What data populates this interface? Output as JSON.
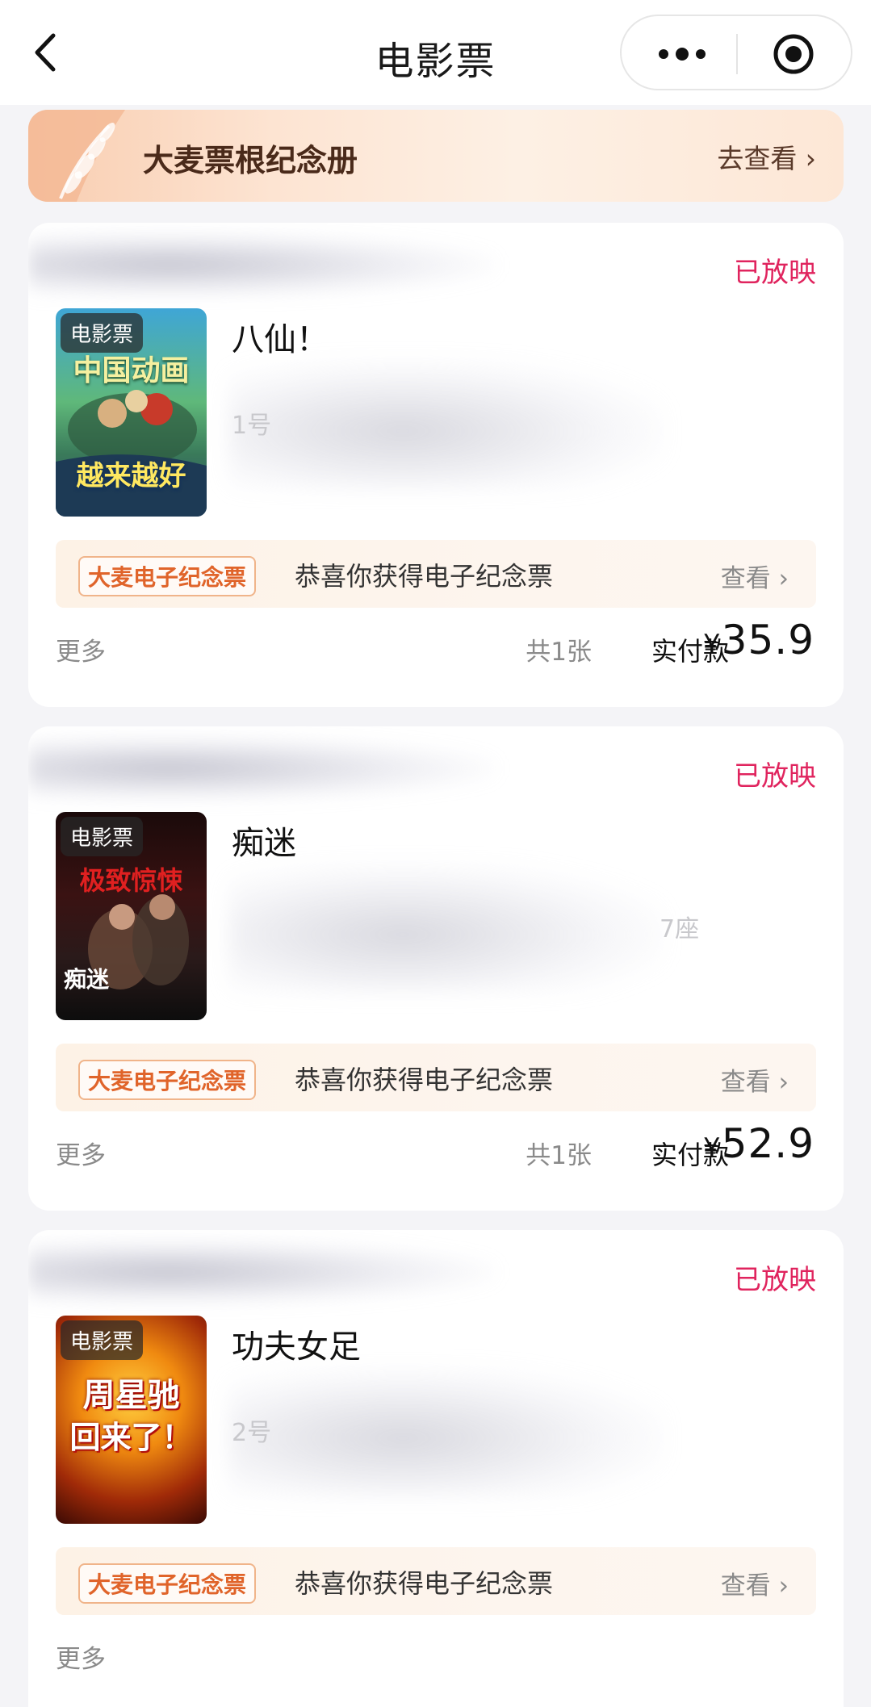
{
  "header": {
    "title": "电影票"
  },
  "banner": {
    "title": "大麦票根纪念册",
    "action": "去查看 ›"
  },
  "orders": [
    {
      "status": "已放映",
      "poster_tag": "电影票",
      "poster_text_top": "中国动画",
      "poster_text_bottom": "越来越好",
      "movie_title": "八仙！",
      "detail_fragment": "1号",
      "souvenir_tag": "大麦电子纪念票",
      "souvenir_msg": "恭喜你获得电子纪念票",
      "souvenir_view": "查看 ›",
      "more": "更多",
      "count": "共1张",
      "paid_label": "实付款",
      "currency": "¥",
      "price": "35.9"
    },
    {
      "status": "已放映",
      "poster_tag": "电影票",
      "poster_text_top": "极致惊悚",
      "poster_text_bottom": "痴迷",
      "movie_title": "痴迷",
      "detail_fragment": "7座",
      "souvenir_tag": "大麦电子纪念票",
      "souvenir_msg": "恭喜你获得电子纪念票",
      "souvenir_view": "查看 ›",
      "more": "更多",
      "count": "共1张",
      "paid_label": "实付款",
      "currency": "¥",
      "price": "52.9"
    },
    {
      "status": "已放映",
      "poster_tag": "电影票",
      "poster_text_top": "周星驰",
      "poster_text_bottom": "回来了！",
      "movie_title": "功夫女足",
      "detail_fragment": "2号",
      "souvenir_tag": "大麦电子纪念票",
      "souvenir_msg": "恭喜你获得电子纪念票",
      "souvenir_view": "查看 ›",
      "more": "更多"
    }
  ],
  "colors": {
    "status": "#e0245e",
    "souvenir_tag": "#e0642a",
    "page_bg": "#f4f4f7"
  },
  "icons": [
    "back-arrow-icon",
    "more-dots-icon",
    "target-icon",
    "wheat-leaf-icon"
  ]
}
